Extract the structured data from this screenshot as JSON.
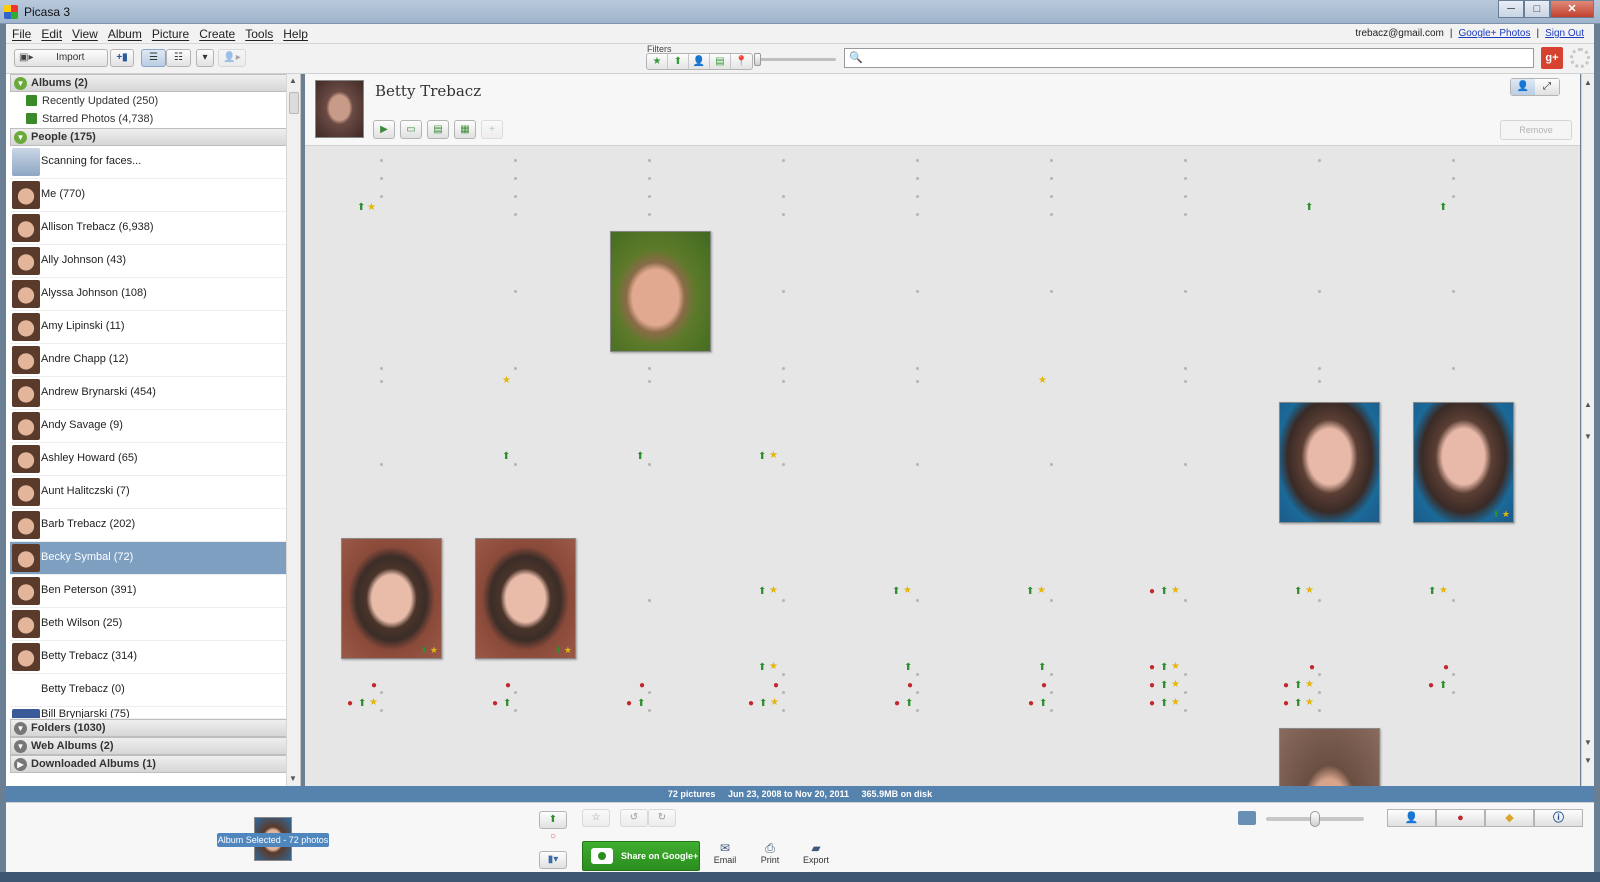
{
  "window": {
    "title": "Picasa 3",
    "buttons": {
      "minimize": "─",
      "maximize": "□",
      "close": "✕"
    }
  },
  "menu": {
    "items": [
      "File",
      "Edit",
      "View",
      "Album",
      "Picture",
      "Create",
      "Tools",
      "Help"
    ],
    "account_email": "trebacz@gmail.com",
    "google_photos": "Google+ Photos",
    "sign_out": "Sign Out"
  },
  "toolbar": {
    "import_label": "Import",
    "filters_label": "Filters",
    "filter_icons": [
      "★",
      "⬆",
      "👤",
      "▤",
      "📍"
    ],
    "search": {
      "value": "",
      "placeholder": ""
    },
    "gplus_label": "g+"
  },
  "sidebar": {
    "albums_header": "Albums (2)",
    "albums": [
      "Recently Updated (250)",
      "Starred Photos (4,738)"
    ],
    "people_header": "People (175)",
    "people": [
      "Scanning for faces...",
      "Me (770)",
      "Allison Trebacz (6,938)",
      "Ally Johnson (43)",
      "Alyssa Johnson (108)",
      "Amy Lipinski (11)",
      "Andre Chapp (12)",
      "Andrew Brynarski (454)",
      "Andy Savage (9)",
      "Ashley Howard (65)",
      "Aunt Halitczski (7)",
      "Barb Trebacz (202)",
      "Becky Symbal (72)",
      "Ben Peterson (391)",
      "Beth Wilson (25)",
      "Betty Trebacz (314)",
      "Betty Trebacz (0)",
      "Bill Brynjarski (75)"
    ],
    "selected_person": "Becky Symbal (72)",
    "folders_header": "Folders (1030)",
    "web_albums_header": "Web Albums (2)",
    "downloaded_header": "Downloaded Albums (1)"
  },
  "main": {
    "person_name": "Betty Trebacz",
    "header_buttons": [
      "▶",
      "▭",
      "▤",
      "▦",
      "+"
    ],
    "remove_label": "Remove"
  },
  "status": {
    "count": "72 pictures",
    "date_range": "Jun 23, 2008 to Nov 20, 2011",
    "disk": "365.9MB on disk"
  },
  "tray": {
    "selected_badge": "Album Selected - 72 photos",
    "share_label": "Share on Google+",
    "actions": [
      "Email",
      "Print",
      "Export"
    ]
  },
  "colors": {
    "selection": "#7f9fc0",
    "status_bar": "#5683ad",
    "share_green": "#2b8d1f",
    "pin_red": "#c1272d",
    "star_yellow": "#e3b60a",
    "arrow_green": "#2f8f2f"
  }
}
